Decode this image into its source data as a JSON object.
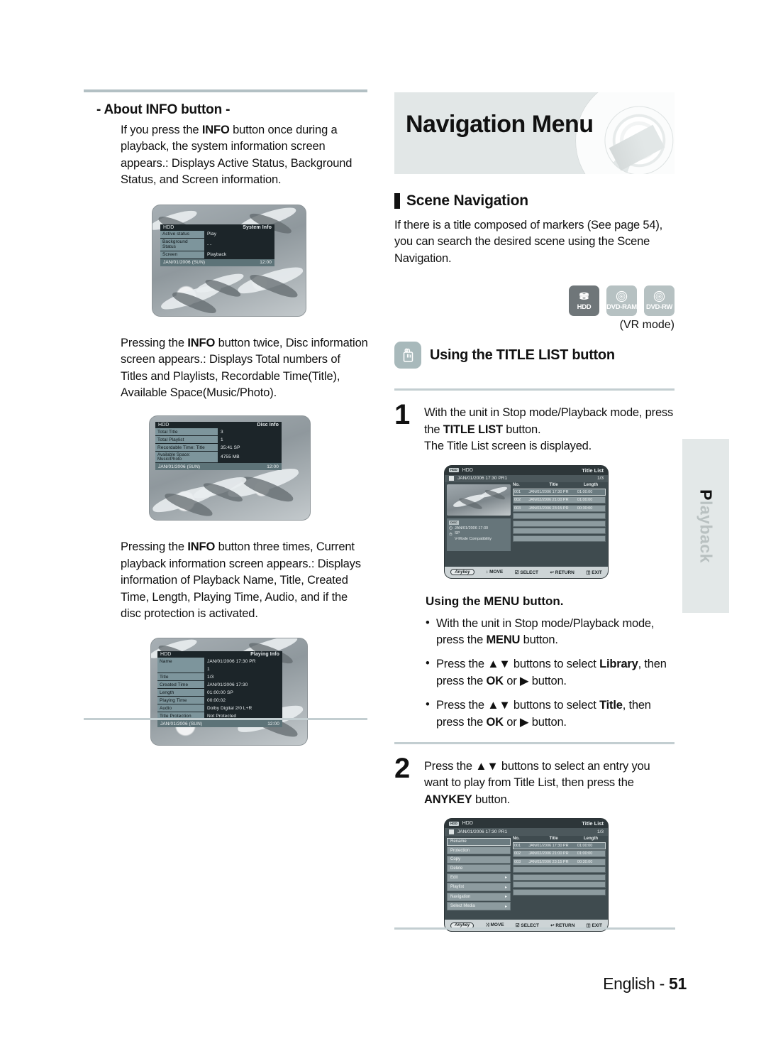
{
  "page": {
    "footer_language": "English - ",
    "footer_number": "51",
    "side_tab": "Playback"
  },
  "left": {
    "section_title": "- About INFO button -",
    "para1": "If you press the INFO button once during a playback, the system information screen appears.: Displays Active Status, Background Status, and Screen information.",
    "para1_parts": {
      "a": "If you press the ",
      "b": "INFO",
      "c": " button once during a playback, the system information screen appears.: Displays Active Status, Background Status, and Screen information."
    },
    "para2_parts": {
      "a": "Pressing the ",
      "b": "INFO",
      "c": " button twice, Disc information screen appears.: Displays Total numbers of Titles and Playlists, Recordable Time(Title), Available Space(Music/Photo)."
    },
    "para3_parts": {
      "a": "Pressing the ",
      "b": "INFO",
      "c": " button three times, Current playback information screen appears.: Displays information of Playback Name, Title, Created Time, Length, Playing Time, Audio, and if the disc protection is activated."
    },
    "system_info": {
      "source": "HDD",
      "screen_title": "System Info",
      "rows": [
        {
          "key": "Active status",
          "value": "Play"
        },
        {
          "key": "Background Status",
          "value": "- -"
        },
        {
          "key": "Screen",
          "value": "Playback"
        }
      ],
      "date": "JAN/01/2006 (SUN)",
      "time": "12:00"
    },
    "disc_info": {
      "source": "HDD",
      "screen_title": "Disc Info",
      "rows": [
        {
          "key": "Total Title",
          "value": "3"
        },
        {
          "key": "Total Playlist",
          "value": "1"
        },
        {
          "key": "Recordable Time: Title",
          "value": "35:41  SP"
        },
        {
          "key": "Available Space: Music/Photo",
          "value": "4755 MB"
        }
      ],
      "date": "JAN/01/2006 (SUN)",
      "time": "12:00"
    },
    "playing_info": {
      "source": "HDD",
      "screen_title": "Playing Info",
      "rows": [
        {
          "key": "Name",
          "value": "JAN/01/2006 17:30 PR"
        },
        {
          "key": "",
          "value": "1"
        },
        {
          "key": "Title",
          "value": "1/3"
        },
        {
          "key": "Created Time",
          "value": "JAN/01/2006 17:30"
        },
        {
          "key": "Length",
          "value": "01:00:00 SP"
        },
        {
          "key": "Playing Time",
          "value": "00:00:02"
        },
        {
          "key": "Audio",
          "value": "Dolby Digital 2/0 L+R"
        },
        {
          "key": "Title Protection",
          "value": "Not Protected"
        }
      ],
      "date": "JAN/01/2006 (SUN)",
      "time": "12:00"
    }
  },
  "right": {
    "banner_title": "Navigation Menu",
    "scene_nav_heading": "Scene Navigation",
    "scene_nav_para": "If there is a title composed of markers (See page 54), you can search the desired scene using the Scene Navigation.",
    "badges": [
      {
        "label": "HDD",
        "style": "dark",
        "icon": "hdd-disc-stack-icon"
      },
      {
        "label": "DVD-RAM",
        "style": "light",
        "icon": "disc-icon"
      },
      {
        "label": "DVD-RW",
        "style": "light",
        "icon": "disc-icon"
      }
    ],
    "vr_mode": "(VR mode)",
    "titlelist_heading": "Using the TITLE LIST button",
    "titlelist_icon": "press-button-hand-icon",
    "step1": {
      "number": "1",
      "line1_a": "With the unit in Stop mode/Playback mode, press the ",
      "line1_b": "TITLE LIST",
      "line1_c": " button.",
      "line2": "The Title List screen is displayed."
    },
    "menu_subhead": "Using the MENU button.",
    "menu_bullets": [
      {
        "a": "With the unit in Stop mode/Playback mode, press the ",
        "b": "MENU",
        "c": " button."
      },
      {
        "a": "Press the ▲▼ buttons to select ",
        "b": "Library",
        "c": ", then press the ",
        "d": "OK",
        "e": " or ▶ button."
      },
      {
        "a": "Press the ▲▼ buttons to select ",
        "b": "Title",
        "c": ", then press the ",
        "d": "OK",
        "e": " or ▶ button."
      }
    ],
    "step2": {
      "number": "2",
      "line1": "Press the ▲▼ buttons to select an entry you want to play from Title List, then press the ",
      "line1_b": "ANYKEY",
      "line1_c": " button."
    },
    "title_list_screen": {
      "source_chip": "HDD",
      "source": "HDD",
      "screen_title": "Title List",
      "current_name": "JAN/01/2006 17:30 PR1",
      "page_indicator": "1/3",
      "columns": [
        "No.",
        "Title",
        "Length"
      ],
      "rows": [
        {
          "no": "001",
          "title": "JAN/01/2006 17:30 PR",
          "length": "01:00:00",
          "selected": true
        },
        {
          "no": "002",
          "title": "JAN/02/2006 21:00 PR",
          "length": "01:00:00",
          "selected": false
        },
        {
          "no": "003",
          "title": "JAN/03/2006 23:15 PR",
          "length": "00:30:00",
          "selected": false
        }
      ],
      "empty_rows": 4,
      "info_panel": {
        "chip": "DISC",
        "created": "JAN/01/2006 17:30",
        "mode": "SP",
        "compat": "V-Mode Compatibility"
      },
      "footer": {
        "anykey": "Anykey",
        "move": "MOVE",
        "select": "SELECT",
        "return": "RETURN",
        "exit": "EXIT"
      }
    },
    "title_list_menu_screen": {
      "source_chip": "HDD",
      "source": "HDD",
      "screen_title": "Title List",
      "current_name": "JAN/01/2006 17:30 PR1",
      "page_indicator": "1/3",
      "columns": [
        "No.",
        "Title",
        "Length"
      ],
      "menu_items": [
        {
          "label": "Rename",
          "arrow": "",
          "selected": true
        },
        {
          "label": "Protection",
          "arrow": "",
          "selected": false
        },
        {
          "label": "Copy",
          "arrow": "",
          "selected": false
        },
        {
          "label": "Delete",
          "arrow": "",
          "selected": false
        },
        {
          "label": "Edit",
          "arrow": "▸",
          "selected": false
        },
        {
          "label": "Playlist",
          "arrow": "▸",
          "selected": false
        },
        {
          "label": "Navigation",
          "arrow": "▸",
          "selected": false
        },
        {
          "label": "Select Media",
          "arrow": "▸",
          "selected": false
        }
      ],
      "rows": [
        {
          "no": "001",
          "title": "JAN/01/2006 17:30 PR",
          "length": "01:00:00",
          "selected": true
        },
        {
          "no": "002",
          "title": "JAN/02/2006 21:00 PR",
          "length": "01:00:00",
          "selected": false
        },
        {
          "no": "003",
          "title": "JAN/03/2006 23:15 PR",
          "length": "00:30:00",
          "selected": false
        }
      ],
      "footer": {
        "anykey": "Anykey",
        "move": "MOVE",
        "select": "SELECT",
        "return": "RETURN",
        "exit": "EXIT"
      }
    }
  },
  "colors": {
    "divider": "#b3c0c4",
    "banner_bg": "#e2e7e7",
    "badge_dark": "#6f7679",
    "badge_light": "#b6c1c2",
    "icon_bg": "#a8b9bb",
    "osd_bg": "#1c2529",
    "osd_key": "#7d959c"
  }
}
